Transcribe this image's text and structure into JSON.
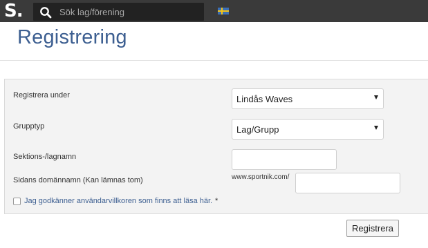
{
  "header": {
    "logo": "S.",
    "search": {
      "placeholder": "Sök lag/förening",
      "value": ""
    },
    "flag_icon": "sweden-flag-icon",
    "search_icon": "search-icon"
  },
  "page": {
    "title": "Registrering"
  },
  "form": {
    "register_under": {
      "label": "Registrera under",
      "selected": "Lindås Waves"
    },
    "group_type": {
      "label": "Grupptyp",
      "selected": "Lag/Grupp"
    },
    "section_name": {
      "label": "Sektions-/lagnamn",
      "value": ""
    },
    "domain": {
      "label": "Sidans domännamn (Kan lämnas tom)",
      "prefix": "www.sportnik.com/",
      "value": ""
    },
    "terms": {
      "checked": false,
      "link_text": "Jag godkänner användarvillkoren som finns att läsa här.",
      "required_mark": "*"
    },
    "submit_label": "Registrera"
  },
  "colors": {
    "topbar": "#3a3a3a",
    "title": "#3d5f91",
    "link": "#3d5f91",
    "panel": "#f3f3f3"
  }
}
